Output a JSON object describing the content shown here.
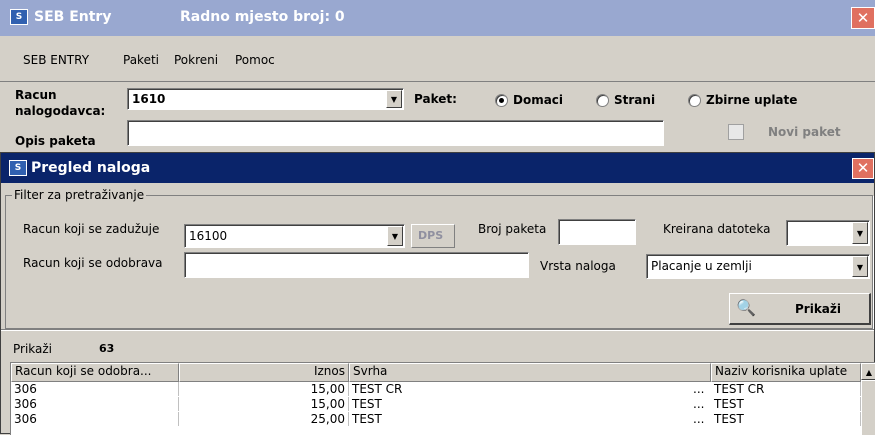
{
  "main_window": {
    "title": "SEB Entry",
    "subtitle": "Radno mjesto broj: 0",
    "close_glyph": "✕",
    "icon_text": "S"
  },
  "menu": [
    "SEB ENTRY",
    "Paketi",
    "Pokreni",
    "Pomoc"
  ],
  "entry_form": {
    "racun_label_1": "Racun",
    "racun_label_2": "nalogodavca:",
    "racun_value": "1610",
    "paket_label": "Paket:",
    "radio_options": [
      "Domaci",
      "Strani",
      "Zbirne uplate"
    ],
    "radio_selected": "Domaci",
    "opis_label": "Opis paketa",
    "opis_value": "",
    "novi_paket_label": "Novi paket"
  },
  "dialog": {
    "title": "Pregled naloga",
    "close_glyph": "✕",
    "filter_legend": "Filter za pretraživanje",
    "zaduzuje_label": "Racun koji se zadužuje",
    "zaduzuje_value": "16100",
    "dps_label": "DPS",
    "broj_paketa_label": "Broj paketa",
    "broj_paketa_value": "",
    "kreirana_label": "Kreirana datoteka",
    "kreirana_value": "",
    "odobrava_label": "Racun koji se odobrava",
    "odobrava_value": "",
    "vrsta_label": "Vrsta naloga",
    "vrsta_value": "Placanje u zemlji",
    "prikazi_label": "Prikaži",
    "prikazi_count_label": "Prikaži",
    "prikazi_count_value": "63"
  },
  "table": {
    "columns": [
      "Racun koji se odobra...",
      "Iznos",
      "Svrha",
      "Naziv korisnika uplate"
    ],
    "rows": [
      {
        "racun": "306",
        "iznos": "15,00",
        "svrha": "TEST CR",
        "more": "...",
        "naziv": "TEST CR"
      },
      {
        "racun": "306",
        "iznos": "15,00",
        "svrha": "TEST",
        "more": "...",
        "naziv": "TEST"
      },
      {
        "racun": "306",
        "iznos": "25,00",
        "svrha": "TEST",
        "more": "...",
        "naziv": "TEST"
      }
    ]
  },
  "colors": {
    "titlebar_inactive": "#99a8d0",
    "titlebar_active": "#0a246a",
    "face": "#d4d0c8",
    "close": "#e07060"
  }
}
